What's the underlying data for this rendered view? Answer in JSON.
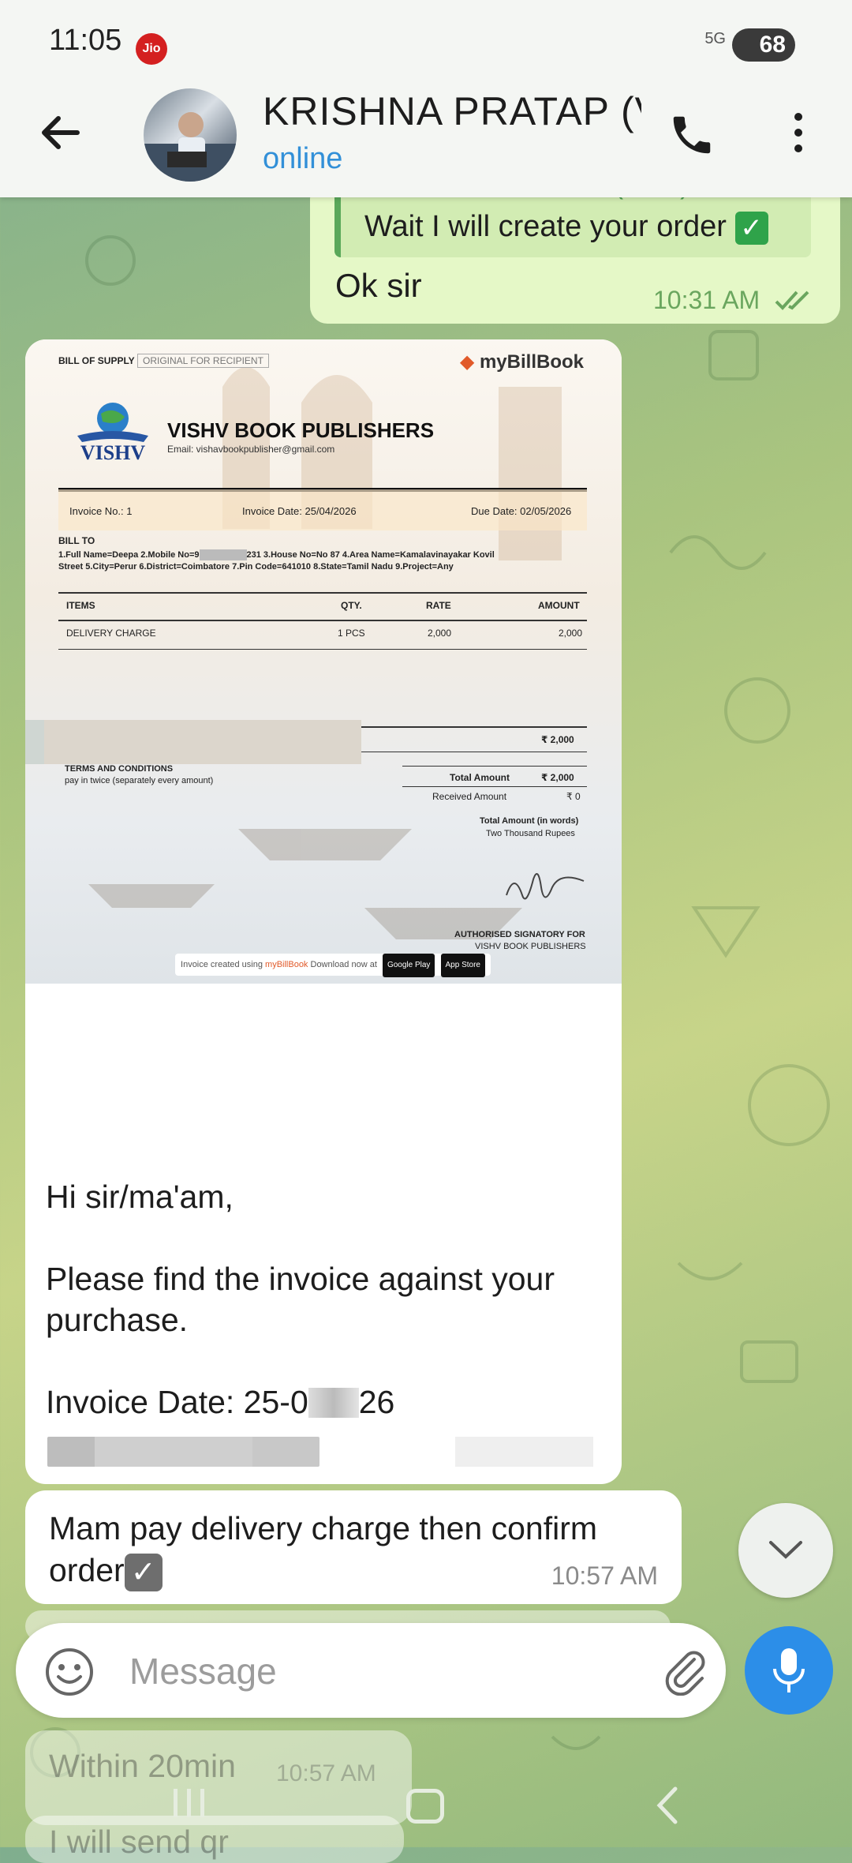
{
  "status_bar": {
    "time": "11:05",
    "carrier": "Jio",
    "network": "5G",
    "battery": "68"
  },
  "header": {
    "contact_name": "KRISHNA PRATAP (V",
    "presence": "online"
  },
  "messages": {
    "outgoing": {
      "quoted_sender": "KRISHNA PRATAP (VBP)",
      "quoted_text": "Wait I will create your order",
      "text": "Ok sir",
      "time": "10:31 AM"
    },
    "invoice": {
      "doc_type": "BILL OF SUPPLY",
      "doc_copy": "ORIGINAL FOR RECIPIENT",
      "brand": "myBillBook",
      "publisher": "VISHV BOOK PUBLISHERS",
      "email": "Email: vishavbookpublisher@gmail.com",
      "logo_text": "VISHV",
      "invoice_no": "Invoice No.: 1",
      "invoice_date": "Invoice Date: 25/04/2026",
      "due_date": "Due Date: 02/05/2026",
      "bill_to_label": "BILL TO",
      "bill_to_line1": "1.Full Name=Deepa 2.Mobile No=9",
      "bill_to_line1b": "231 3.House No=No 87 4.Area Name=Kamalavinayakar Kovil",
      "bill_to_line2": "Street 5.City=Perur 6.District=Coimbatore 7.Pin Code=641010 8.State=Tamil Nadu 9.Project=Any",
      "columns": [
        "ITEMS",
        "QTY.",
        "RATE",
        "AMOUNT"
      ],
      "rows": [
        {
          "item": "DELIVERY CHARGE",
          "qty": "1 PCS",
          "rate": "2,000",
          "amount": "2,000"
        }
      ],
      "subtotal": "₹ 2,000",
      "terms_title": "TERMS AND CONDITIONS",
      "terms_text": "pay in twice (separately every amount)",
      "total_label": "Total Amount",
      "total_value": "₹ 2,000",
      "received_label": "Received Amount",
      "received_value": "₹ 0",
      "words_label": "Total Amount (in words)",
      "words_value": "Two Thousand Rupees",
      "signatory_line1": "AUTHORISED SIGNATORY FOR",
      "signatory_line2": "VISHV BOOK PUBLISHERS",
      "footer_created": "Invoice created using",
      "footer_brand": "myBillBook",
      "footer_download": "Download now at",
      "footer_store1": "Google Play",
      "footer_store2": "App Store"
    },
    "caption": "Hi sir/ma'am,\n\nPlease find the invoice against your purchase.\n\nInvoice Date: 25-0",
    "caption_tail": "26",
    "incoming2": {
      "text": "Mam pay delivery charge then confirm order",
      "time": "10:57 AM"
    },
    "faded1": {
      "text": "Within 20min",
      "time": "10:57 AM"
    },
    "faded2": {
      "text": "I will send qr"
    }
  },
  "composer": {
    "placeholder": "Message"
  },
  "colors": {
    "header_bg": "#f4f6f3",
    "outgoing_bubble": "#e5f8c7",
    "accent_blue": "#2c8ee8",
    "online_blue": "#3290d8"
  }
}
